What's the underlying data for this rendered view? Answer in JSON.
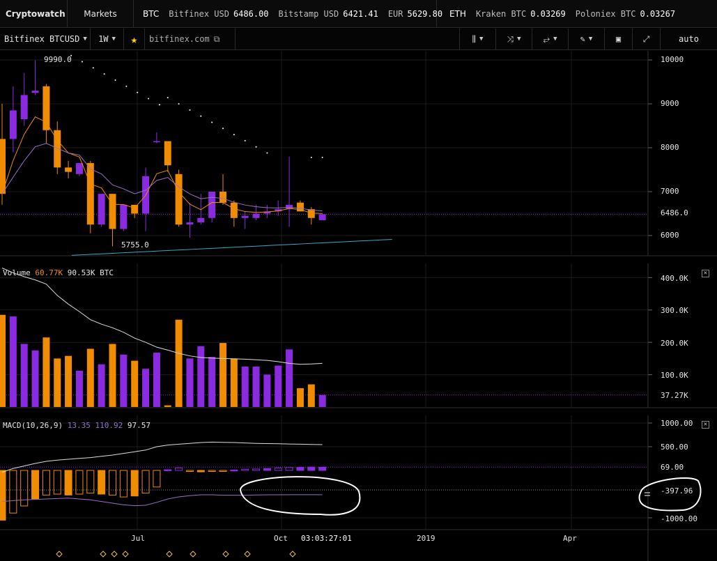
{
  "topbar": {
    "brand": "Cryptowatch",
    "markets": "Markets",
    "btc": {
      "label": "BTC",
      "quotes": [
        {
          "exchange": "Bitfinex USD",
          "price": "6486.00"
        },
        {
          "exchange": "Bitstamp USD",
          "price": "6421.41"
        },
        {
          "exchange": "EUR",
          "price": "5629.80"
        }
      ]
    },
    "eth": {
      "label": "ETH",
      "quotes": [
        {
          "exchange": "Kraken BTC",
          "price": "0.03269"
        },
        {
          "exchange": "Poloniex BTC",
          "price": "0.03267"
        }
      ]
    }
  },
  "toolbar": {
    "market": "Bitfinex BTCUSD",
    "period": "1W",
    "url": "bitfinex.com",
    "auto": "auto",
    "icons": [
      "candle-type-icon",
      "indicators-icon",
      "compare-icon",
      "draw-pen-icon",
      "screenshot-icon",
      "fullscreen-icon"
    ]
  },
  "price_pane": {
    "high_label": "9990.0",
    "low_label": "5755.0",
    "last_price": "6486.0",
    "axis_ticks": [
      "10000",
      "9000",
      "8000",
      "7000",
      "6000"
    ],
    "colors": {
      "up": "#8a2be2",
      "down": "#f08c00",
      "ema_short": "#f08c00",
      "ema_long": "#9b6fc9",
      "ema_slow": "#3aa9c9",
      "sar": "#ffffff"
    }
  },
  "volume_pane": {
    "title": "Volume",
    "value_orange": "60.77K",
    "value_white": "90.53K BTC",
    "axis_ticks": [
      "400.0K",
      "300.0K",
      "200.0K",
      "100.0K"
    ],
    "last": "37.27K"
  },
  "macd_pane": {
    "title": "MACD(10,26,9)",
    "v1": "13.35",
    "v2": "110.92",
    "v3": "97.57",
    "axis_ticks": [
      "1000.00",
      "500.00",
      "-1000.00"
    ],
    "histogram_last": "69.00",
    "line_last": "-397.96"
  },
  "time_axis": {
    "labels": [
      "Jul",
      "Oct",
      "2019",
      "Apr"
    ],
    "cursor": "03:03:27:01"
  },
  "chart_data": {
    "type": "candlestick",
    "price_ylim": [
      5500,
      10200
    ],
    "candles": [
      {
        "o": 8200,
        "h": 9000,
        "l": 6700,
        "c": 6950
      },
      {
        "o": 8200,
        "h": 9400,
        "l": 7900,
        "c": 8850
      },
      {
        "o": 8650,
        "h": 9700,
        "l": 8500,
        "c": 9200
      },
      {
        "o": 9250,
        "h": 9990,
        "l": 9200,
        "c": 9300
      },
      {
        "o": 9400,
        "h": 9450,
        "l": 8100,
        "c": 8400
      },
      {
        "o": 8400,
        "h": 8600,
        "l": 7400,
        "c": 7550
      },
      {
        "o": 7550,
        "h": 7700,
        "l": 7300,
        "c": 7450
      },
      {
        "o": 7400,
        "h": 7650,
        "l": 7350,
        "c": 7650
      },
      {
        "o": 7650,
        "h": 7700,
        "l": 6050,
        "c": 6250
      },
      {
        "o": 6250,
        "h": 6950,
        "l": 6200,
        "c": 6950
      },
      {
        "o": 6950,
        "h": 6950,
        "l": 5755,
        "c": 6150
      },
      {
        "o": 6150,
        "h": 6700,
        "l": 6100,
        "c": 6700
      },
      {
        "o": 6700,
        "h": 6700,
        "l": 6400,
        "c": 6500
      },
      {
        "o": 6500,
        "h": 7550,
        "l": 6100,
        "c": 7350
      },
      {
        "o": 8150,
        "h": 8350,
        "l": 8100,
        "c": 8150
      },
      {
        "o": 8150,
        "h": 8150,
        "l": 7450,
        "c": 7600
      },
      {
        "o": 7400,
        "h": 7500,
        "l": 6200,
        "c": 6250
      },
      {
        "o": 6250,
        "h": 6750,
        "l": 5950,
        "c": 6300
      },
      {
        "o": 6300,
        "h": 6950,
        "l": 6250,
        "c": 6400
      },
      {
        "o": 6400,
        "h": 7000,
        "l": 6300,
        "c": 7000
      },
      {
        "o": 7000,
        "h": 7400,
        "l": 6700,
        "c": 6750
      },
      {
        "o": 6750,
        "h": 6800,
        "l": 6200,
        "c": 6400
      },
      {
        "o": 6400,
        "h": 6550,
        "l": 6150,
        "c": 6450
      },
      {
        "o": 6400,
        "h": 6700,
        "l": 6350,
        "c": 6500
      },
      {
        "o": 6500,
        "h": 6700,
        "l": 6400,
        "c": 6550
      },
      {
        "o": 6550,
        "h": 6800,
        "l": 6450,
        "c": 6600
      },
      {
        "o": 6600,
        "h": 7800,
        "l": 6200,
        "c": 6700
      },
      {
        "o": 6750,
        "h": 6800,
        "l": 6550,
        "c": 6550
      },
      {
        "o": 6600,
        "h": 6650,
        "l": 6250,
        "c": 6400
      },
      {
        "o": 6350,
        "h": 6500,
        "l": 6350,
        "c": 6486
      }
    ],
    "volume_ylim": [
      0,
      420
    ],
    "volume_k": [
      285,
      280,
      195,
      175,
      215,
      150,
      158,
      112,
      180,
      132,
      195,
      162,
      143,
      118,
      168,
      5,
      270,
      150,
      188,
      155,
      198,
      150,
      125,
      125,
      100,
      128,
      178,
      58,
      70,
      37.27
    ],
    "volume_ma_k": [
      430,
      415,
      403,
      393,
      380,
      345,
      318,
      295,
      270,
      256,
      245,
      231,
      213,
      200,
      185,
      176,
      166,
      158,
      153,
      151,
      150,
      149,
      148,
      146,
      144,
      140,
      135,
      132,
      133,
      135
    ],
    "macd_ylim": [
      -1500,
      1050
    ],
    "macd_histogram": [
      -1050,
      -900,
      -750,
      -600,
      -520,
      -500,
      -520,
      -500,
      -480,
      -500,
      -520,
      -560,
      -540,
      -480,
      -350,
      15,
      50,
      -20,
      -30,
      -20,
      -10,
      10,
      25,
      30,
      40,
      50,
      60,
      65,
      70,
      69
    ]
  }
}
